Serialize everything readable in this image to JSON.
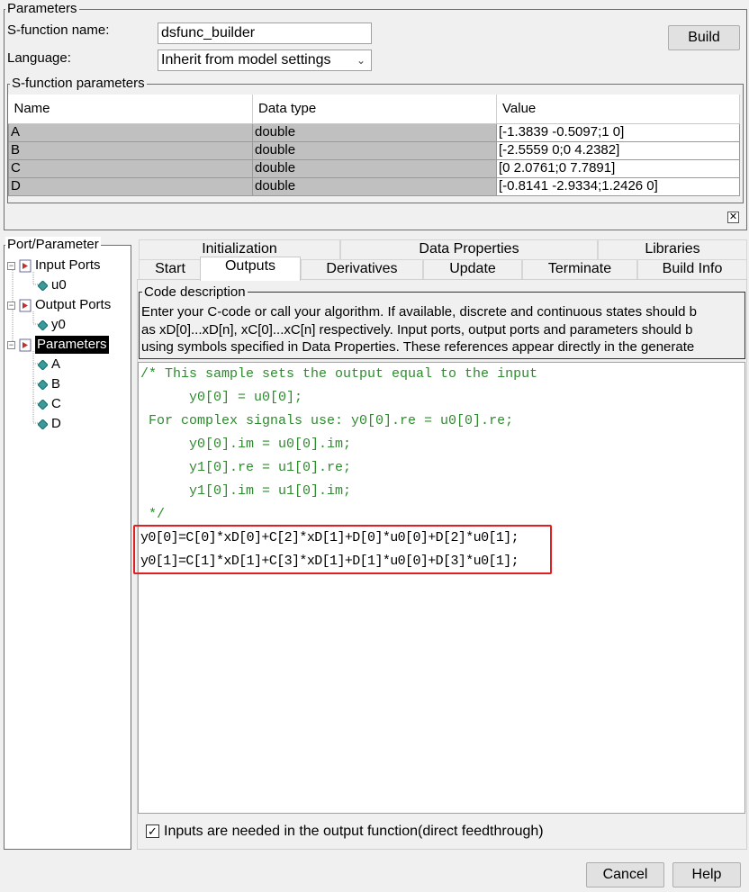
{
  "parameters_group": {
    "legend": "Parameters",
    "sfunction_name_label": "S-function name:",
    "sfunction_name_value": "dsfunc_builder",
    "language_label": "Language:",
    "language_value": "Inherit from model settings",
    "build_button": "Build"
  },
  "sfunction_params": {
    "legend": "S-function parameters",
    "columns": [
      "Name",
      "Data type",
      "Value"
    ],
    "rows": [
      {
        "name": "A",
        "type": "double",
        "value": "[-1.3839 -0.5097;1 0]"
      },
      {
        "name": "B",
        "type": "double",
        "value": "[-2.5559 0;0 4.2382]"
      },
      {
        "name": "C",
        "type": "double",
        "value": "[0 2.0761;0 7.7891]"
      },
      {
        "name": "D",
        "type": "double",
        "value": "[-0.8141 -2.9334;1.2426 0]"
      }
    ],
    "close_icon": "close-icon"
  },
  "port_parameter": {
    "legend": "Port/Parameter",
    "tree": [
      {
        "label": "Input Ports",
        "children": [
          "u0"
        ]
      },
      {
        "label": "Output Ports",
        "children": [
          "y0"
        ]
      },
      {
        "label": "Parameters",
        "children": [
          "A",
          "B",
          "C",
          "D"
        ],
        "selected": true
      }
    ]
  },
  "tabs": {
    "row_top": [
      "Initialization",
      "Data Properties",
      "Libraries"
    ],
    "row_bottom": [
      "Start",
      "Outputs",
      "Derivatives",
      "Update",
      "Terminate",
      "Build Info"
    ],
    "active": "Outputs"
  },
  "code_description": {
    "legend": "Code description",
    "lines": [
      "Enter your C-code or call your algorithm. If available, discrete and continuous states should b",
      "as xD[0]...xD[n], xC[0]...xC[n] respectively. Input ports, output ports and parameters should b",
      "using symbols specified in Data Properties. These references appear directly in the generate"
    ]
  },
  "code_editor": {
    "comment_lines": [
      "/* This sample sets the output equal to the input",
      "      y0[0] = u0[0];",
      " For complex signals use: y0[0].re = u0[0].re;",
      "      y0[0].im = u0[0].im;",
      "      y1[0].re = u1[0].re;",
      "      y1[0].im = u1[0].im;",
      " */"
    ],
    "code_lines": [
      "y0[0]=C[0]*xD[0]+C[2]*xD[1]+D[0]*u0[0]+D[2]*u0[1];",
      "y0[1]=C[1]*xD[1]+C[3]*xD[1]+D[1]*u0[0]+D[3]*u0[1];"
    ],
    "highlight_color": "#e02020"
  },
  "feedthrough": {
    "checked": true,
    "label": "Inputs are needed in the output function(direct feedthrough)"
  },
  "footer": {
    "cancel": "Cancel",
    "help": "Help"
  }
}
